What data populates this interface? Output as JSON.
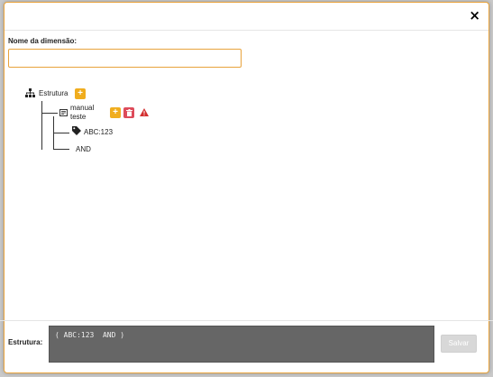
{
  "header": {
    "close_label": "×"
  },
  "form": {
    "name_label": "Nome da dimensão:",
    "name_value": ""
  },
  "tree": {
    "root_label": "Estrutura",
    "add_label": "+",
    "node_label_line1": "manual",
    "node_label_line2": "teste",
    "delete_label": "🗑",
    "children": [
      {
        "label": "ABC:123"
      },
      {
        "label": "AND"
      }
    ]
  },
  "footer": {
    "structure_label": "Estrutura:",
    "structure_value": "( ABC:123  AND )",
    "save_label": "Salvar"
  },
  "colors": {
    "accent": "#f0ad1e",
    "danger": "#dd4b5a",
    "border_accent": "#e8a33c"
  },
  "icons": [
    "close-icon",
    "sitemap-icon",
    "plus-icon",
    "trash-icon",
    "warning-icon",
    "tag-icon",
    "dimension-icon"
  ]
}
